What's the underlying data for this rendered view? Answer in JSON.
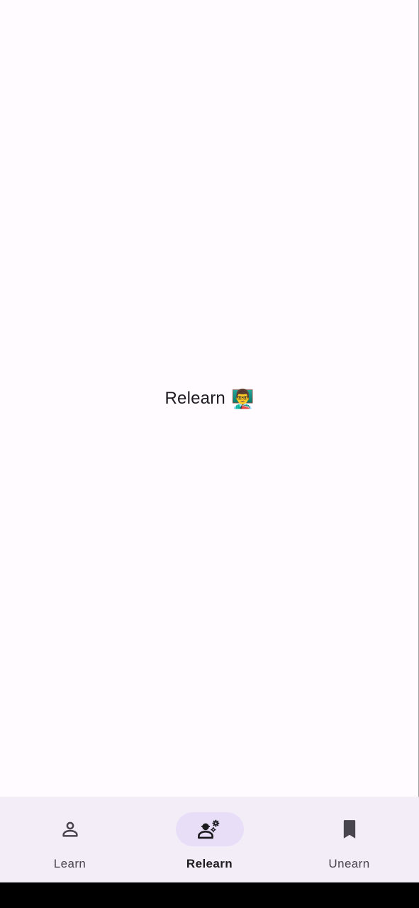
{
  "main": {
    "title": "Relearn",
    "emoji": "👨‍🏫"
  },
  "navigation": {
    "active": "relearn",
    "items": [
      {
        "id": "learn",
        "label": "Learn",
        "icon": "person-outline-icon"
      },
      {
        "id": "relearn",
        "label": "Relearn",
        "icon": "engineering-icon"
      },
      {
        "id": "unearn",
        "label": "Unearn",
        "icon": "bookmark-icon"
      }
    ]
  },
  "colors": {
    "background": "#fffbfe",
    "navbar": "#f3edf7",
    "active_indicator": "#e8def8",
    "icon": "#49454f",
    "text": "#1c1b1f"
  }
}
